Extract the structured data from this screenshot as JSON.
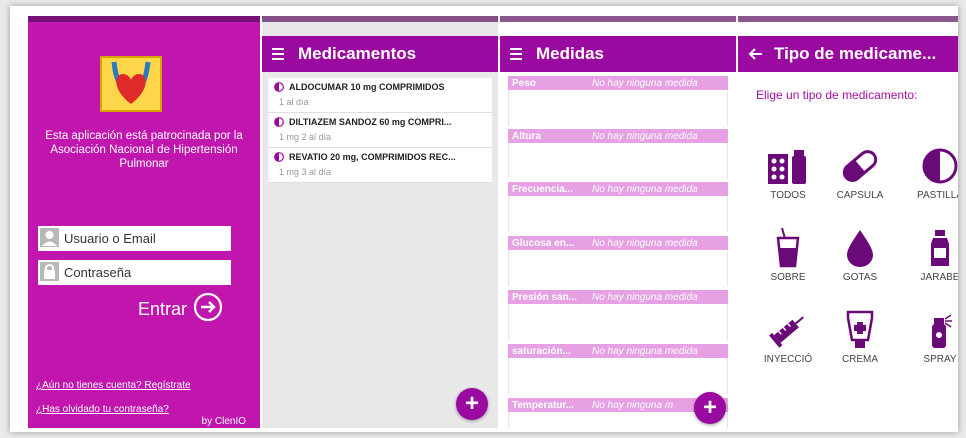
{
  "login": {
    "sponsor_text": "Esta aplicación está patrocinada por la Asociación Nacional de Hipertensión Pulmonar",
    "username_placeholder": "Usuario o Email",
    "password_placeholder": "Contraseña",
    "login_label": "Entrar",
    "register_link": "¿Aún no tienes cuenta? Regístrate",
    "forgot_link": "¿Has olvidado tu contraseña?",
    "credit": "by ClenIO"
  },
  "medications": {
    "title": "Medicamentos",
    "items": [
      {
        "name": "ALDOCUMAR 10 mg COMPRIMIDOS",
        "dose": "1 al día"
      },
      {
        "name": "DILTIAZEM SANDOZ 60 mg COMPRI...",
        "dose": "1 mg 2 al día"
      },
      {
        "name": "REVATIO 20 mg, COMPRIMIDOS REC...",
        "dose": "1 mg 3 al día"
      }
    ],
    "fab_label": "+"
  },
  "measures": {
    "title": "Medidas",
    "items": [
      {
        "name": "Peso",
        "value": "No hay ninguna medida"
      },
      {
        "name": "Altura",
        "value": "No hay ninguna medida"
      },
      {
        "name": "Frecuencia...",
        "value": "No hay ninguna medida"
      },
      {
        "name": "Glucosa en...",
        "value": "No hay ninguna medida"
      },
      {
        "name": "Presión san...",
        "value": "No hay ninguna medida"
      },
      {
        "name": "saturación...",
        "value": "No hay ninguna medida"
      },
      {
        "name": "Temperatur...",
        "value": "No hay ninguna m"
      }
    ],
    "fab_label": "+"
  },
  "med_types": {
    "title": "Tipo de medicame...",
    "prompt": "Elige un tipo de medicamento:",
    "items": [
      {
        "label": "TODOS",
        "icon": "pill-box-icon"
      },
      {
        "label": "CAPSULA",
        "icon": "capsule-icon"
      },
      {
        "label": "PASTILLA",
        "icon": "tablet-icon"
      },
      {
        "label": "SOBRE",
        "icon": "glass-icon"
      },
      {
        "label": "GOTAS",
        "icon": "drop-icon"
      },
      {
        "label": "JARABE",
        "icon": "syrup-bottle-icon"
      },
      {
        "label": "INYECCIÓ",
        "icon": "syringe-icon"
      },
      {
        "label": "CREMA",
        "icon": "cream-tube-icon"
      },
      {
        "label": "SPRAY",
        "icon": "spray-icon"
      }
    ]
  },
  "colors": {
    "accent": "#9b0aa0",
    "login_bg": "#c016ae",
    "measure_header": "#e6a0e4"
  }
}
